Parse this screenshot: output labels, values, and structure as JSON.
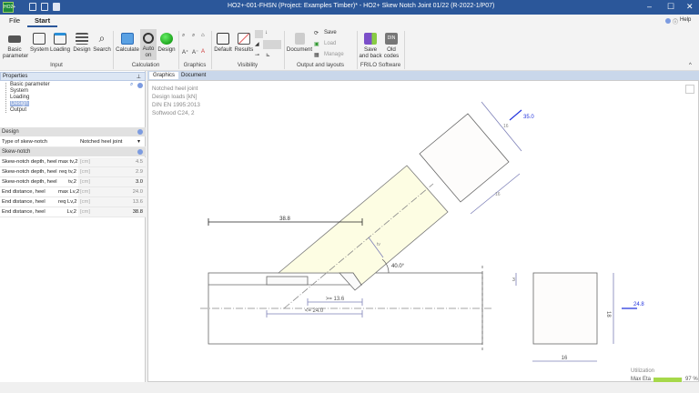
{
  "window": {
    "title": "HO2+-001-FHSN (Project: Examples Timber)* - HO2+ Skew Notch Joint 01/22 (R-2022-1/P07)",
    "app_icon": "HO2+",
    "minimize": "–",
    "maximize": "☐",
    "close": "✕"
  },
  "ribbon_tabs": [
    "File",
    "Start"
  ],
  "help": "Help",
  "ribbon": {
    "input": {
      "label": "Input",
      "buttons": [
        "Basic parameter",
        "System",
        "Loading",
        "Design",
        "Search"
      ]
    },
    "calculation": {
      "label": "Calculation",
      "buttons": [
        "Calculate",
        "Auto on",
        "Design"
      ]
    },
    "graphics": {
      "label": "Graphics"
    },
    "visibility": {
      "label": "Visibility",
      "buttons": [
        "Default",
        "Results"
      ]
    },
    "output": {
      "label": "Output and layouts",
      "buttons": [
        "Document",
        "Save",
        "Load",
        "Manage"
      ]
    },
    "frilo": {
      "label": "FRILO Software",
      "buttons": [
        "Save and back",
        "Old codes"
      ],
      "din": "DIN"
    }
  },
  "properties": {
    "title": "Properties",
    "tree": [
      "Basic parameter",
      "System",
      "Loading",
      "Design",
      "Output"
    ],
    "selected": "Design"
  },
  "design": {
    "title": "Design",
    "type_label": "Type of skew-notch",
    "type_value": "Notched heel joint"
  },
  "skew_notch": {
    "title": "Skew-notch",
    "rows": [
      {
        "label": "Skew-notch depth, heel",
        "sym": "max tv,2",
        "unit": "[cm]",
        "value": "4.5"
      },
      {
        "label": "Skew-notch depth, heel",
        "sym": "req tv,2",
        "unit": "[cm]",
        "value": "2.9"
      },
      {
        "label": "Skew-notch depth, heel",
        "sym": "tv,2",
        "unit": "[cm]",
        "value": "3.0"
      },
      {
        "label": "End distance, heel",
        "sym": "max Lv,2",
        "unit": "[cm]",
        "value": "24.0"
      },
      {
        "label": "End distance, heel",
        "sym": "req Lv,2",
        "unit": "[cm]",
        "value": "13.6"
      },
      {
        "label": "End distance, heel",
        "sym": "Lv,2",
        "unit": "[cm]",
        "value": "38.8"
      }
    ]
  },
  "main_tabs": [
    "Graphics",
    "Document"
  ],
  "graphic": {
    "info": [
      "Notched heel joint",
      "Design loads [kN]",
      "DIN EN 1995:2013",
      "Softwood C24, 2"
    ],
    "dim_top": "38.8",
    "dim_min": ">= 13.6",
    "dim_max": "<= 24.0",
    "angle": "40.0°",
    "tv": "tv",
    "strut_w1": "16",
    "strut_w2": "16",
    "force_strut": "35.0",
    "section_h": "18",
    "section_b": "16",
    "section_t": "3",
    "force_h": "24.8",
    "strut_color": "#fdfde3",
    "force_color": "#2233dd"
  },
  "utilization": {
    "title": "Utilization",
    "label": "Max Eta",
    "percent": 97,
    "text": "97 %",
    "color": "#a6d84a"
  }
}
